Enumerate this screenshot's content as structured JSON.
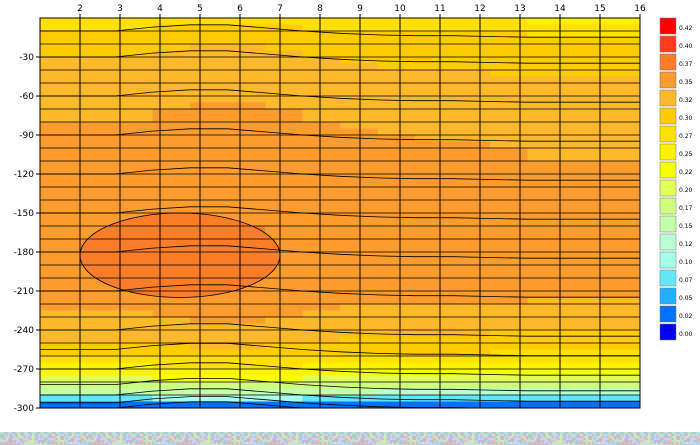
{
  "chart_data": {
    "type": "heatmap",
    "title": "",
    "xlabel": "",
    "ylabel": "",
    "x_axis_position": "top",
    "x_ticks": [
      2,
      3,
      4,
      5,
      6,
      7,
      8,
      9,
      10,
      11,
      12,
      13,
      14,
      15,
      16
    ],
    "y_ticks": [
      -30,
      -60,
      -90,
      -120,
      -150,
      -180,
      -210,
      -240,
      -270,
      -300
    ],
    "xlim": [
      1,
      16
    ],
    "ylim": [
      -300,
      0
    ],
    "grid": true,
    "contour_levels": true,
    "legend_position": "right",
    "colorbar": {
      "labels": [
        "0.42",
        "0.40",
        "0.37",
        "0.35",
        "0.32",
        "0.30",
        "0.27",
        "0.25",
        "0.22",
        "0.20",
        "0.17",
        "0.15",
        "0.12",
        "0.10",
        "0.07",
        "0.05",
        "0.02",
        "0.00"
      ],
      "colors": [
        "#ff0000",
        "#ff3c1e",
        "#fb7d2a",
        "#fc9b2e",
        "#fdb82c",
        "#ffcc00",
        "#ffe000",
        "#fff200",
        "#f5ff00",
        "#e2ff5a",
        "#d0ff80",
        "#c4ffaa",
        "#b8ffd4",
        "#a6ffe8",
        "#60e8f8",
        "#20b0ff",
        "#0070ff",
        "#0000ee"
      ]
    },
    "profiles": [
      {
        "depth": 0,
        "value": 0.26
      },
      {
        "depth": -10,
        "value": 0.29
      },
      {
        "depth": -30,
        "value": 0.31
      },
      {
        "depth": -60,
        "value": 0.325
      },
      {
        "depth": -90,
        "value": 0.34
      },
      {
        "depth": -120,
        "value": 0.345
      },
      {
        "depth": -150,
        "value": 0.35
      },
      {
        "depth": -180,
        "value": 0.355
      },
      {
        "depth": -210,
        "value": 0.35
      },
      {
        "depth": -240,
        "value": 0.32
      },
      {
        "depth": -255,
        "value": 0.3
      },
      {
        "depth": -270,
        "value": 0.25
      },
      {
        "depth": -282,
        "value": 0.18
      },
      {
        "depth": -290,
        "value": 0.12
      },
      {
        "depth": -296,
        "value": 0.03
      },
      {
        "depth": -300,
        "value": 0.02
      }
    ],
    "column_offsets": [
      0.0,
      0.0,
      0.0,
      0.005,
      0.008,
      0.008,
      0.004,
      0.0,
      -0.003,
      -0.005,
      -0.006,
      -0.006,
      -0.007,
      -0.008,
      -0.008,
      -0.008
    ],
    "bulge": {
      "x_range": [
        2,
        7
      ],
      "depth_range": [
        -150,
        -215
      ],
      "value": 0.38
    }
  }
}
